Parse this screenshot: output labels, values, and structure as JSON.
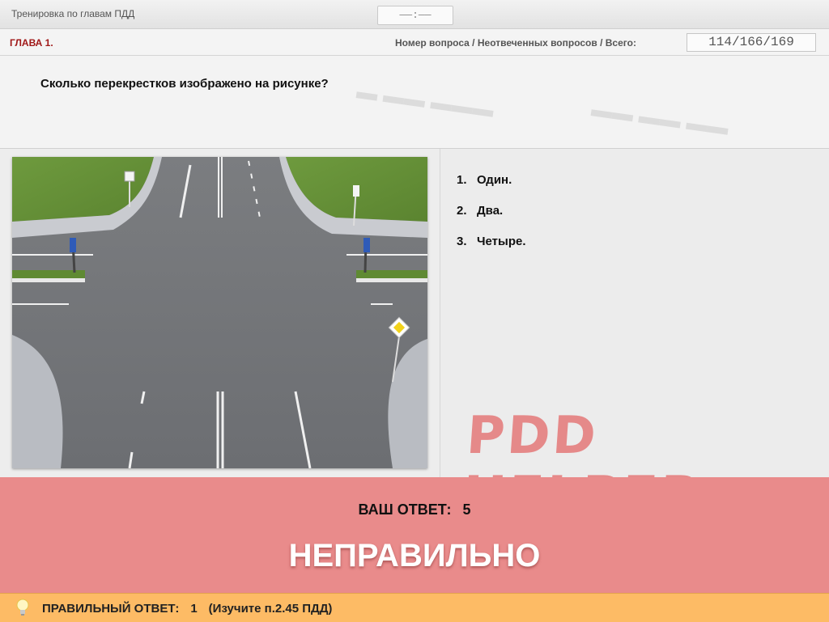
{
  "header": {
    "title": "Тренировка по главам ПДД",
    "timer": "——:——"
  },
  "chapter_bar": {
    "chapter": "ГЛАВА 1.",
    "counter_label": "Номер вопроса / Неотвеченных вопросов / Всего:",
    "counter_value": "114/166/169"
  },
  "question": {
    "text": "Сколько перекрестков изображено на рисунке?"
  },
  "answers": [
    {
      "num": "1.",
      "text": "Один."
    },
    {
      "num": "2.",
      "text": "Два."
    },
    {
      "num": "3.",
      "text": "Четыре."
    }
  ],
  "watermark": "PDD HELPER",
  "result": {
    "your_answer_label": "ВАШ ОТВЕТ:",
    "your_answer_value": "5",
    "verdict": "НЕПРАВИЛЬНО",
    "color": "#e98b8b"
  },
  "footer": {
    "icon": "lightbulb-icon",
    "correct_label": "ПРАВИЛЬНЫЙ ОТВЕТ:",
    "correct_value": "1",
    "hint": "(Изучите п.2.45 ПДД)",
    "color": "#fdbb65"
  }
}
